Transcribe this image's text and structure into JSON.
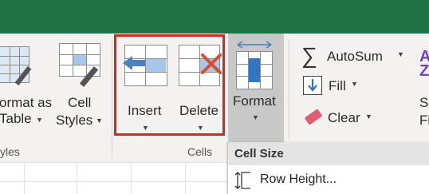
{
  "ribbon": {
    "format_as_table": {
      "line1": "ormat as",
      "line2": "Table"
    },
    "cell_styles": {
      "line1": "Cell",
      "line2": "Styles"
    },
    "styles_group_label": "yles",
    "insert": {
      "label": "Insert"
    },
    "delete": {
      "label": "Delete"
    },
    "format": {
      "label": "Format"
    },
    "cells_group_label": "Cells",
    "autosum": {
      "symbol": "∑",
      "label": "AutoSum"
    },
    "fill": {
      "label": "Fill"
    },
    "clear": {
      "label": "Clear"
    },
    "partial_right": {
      "line1": "S",
      "line2": "Fi"
    }
  },
  "format_menu": {
    "header": "Cell Size",
    "items": [
      {
        "label": "Row Height...",
        "icon": "row-height-icon"
      }
    ]
  },
  "colors": {
    "title_bar": "#217346",
    "highlight_box": "#d9261c",
    "insert_arrow": "#4a7fc1",
    "delete_x": "#d94f2b",
    "autosum_purple": "#6f42c1"
  }
}
